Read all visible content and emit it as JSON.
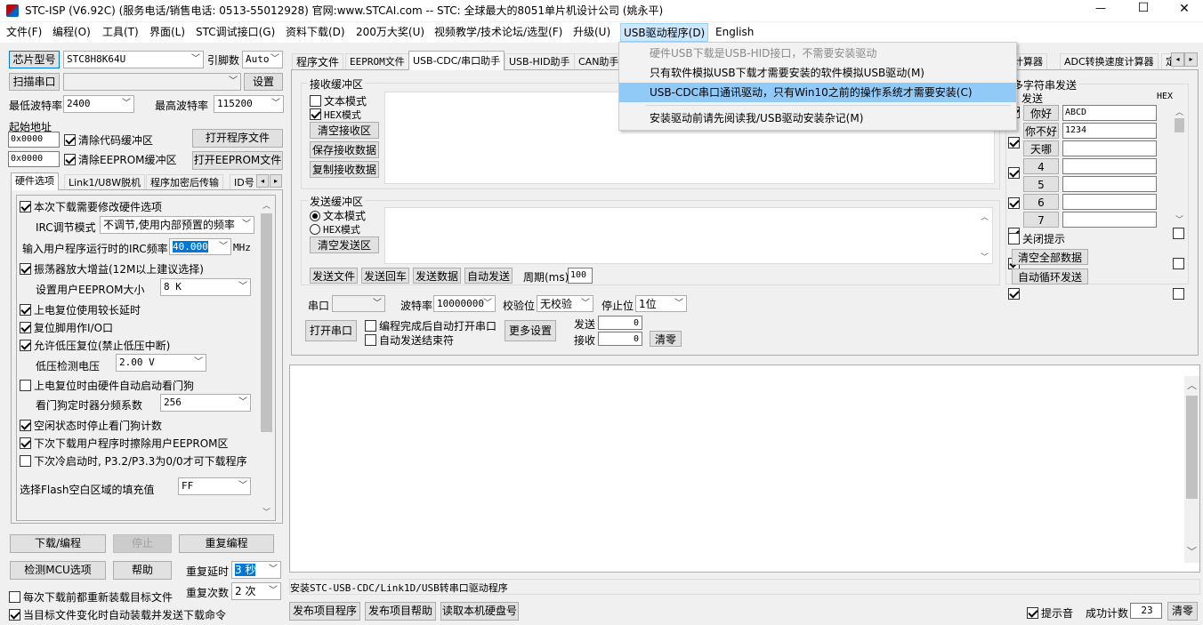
{
  "title_bar": {
    "title": "STC-ISP (V6.92C) (服务电话/销售电话: 0513-55012928) 官网:www.STCAI.com  -- STC: 全球最大的8051单片机设计公司 (姚永平)",
    "minimize": "—",
    "maximize": "☐",
    "close": "✕"
  },
  "menu": [
    "文件(F)",
    "编程(O)",
    "工具(T)",
    "界面(L)",
    "STC调试接口(G)",
    "资料下载(D)",
    "200万大奖(U)",
    "视频教学/技术论坛/选型(F)",
    "升级(U)",
    "USB驱动程序(D)",
    "English"
  ],
  "dropdown": {
    "items": [
      "硬件USB下载是USB-HID接口，不需要安装驱动",
      "只有软件模拟USB下载才需要安装的软件模拟USB驱动(M)",
      "USB-CDC串口通讯驱动，只有Win10之前的操作系统才需要安装(C)",
      "安装驱动前请先阅读我/USB驱动安装杂记(M)"
    ]
  },
  "left": {
    "chip_btn": "芯片型号",
    "chip_value": "STC8H8K64U",
    "pin_label": "引脚数",
    "pin_value": "Auto",
    "scan_btn": "扫描串口",
    "port_value": "",
    "settings_btn": "设置",
    "min_baud_label": "最低波特率",
    "min_baud": "2400",
    "max_baud_label": "最高波特率",
    "max_baud": "115200",
    "start_addr_label": "起始地址",
    "addr1": "0x0000",
    "clear_code": "清除代码缓冲区",
    "open_prog": "打开程序文件",
    "addr2": "0x0000",
    "clear_eeprom": "清除EEPROM缓冲区",
    "open_eeprom": "打开EEPROM文件",
    "tabs": [
      "硬件选项",
      "Link1/U8W脱机",
      "程序加密后传输",
      "ID号"
    ],
    "hw": {
      "o1": "本次下载需要修改硬件选项",
      "irc_mode_label": "IRC调节模式",
      "irc_mode": "不调节,使用内部预置的频率",
      "freq_label": "输入用户程序运行时的IRC频率",
      "freq": "40.000",
      "freq_unit": "MHz",
      "o2": "振荡器放大增益(12M以上建议选择)",
      "eeprom_label": "设置用户EEPROM大小",
      "eeprom": "8   K",
      "o3": "上电复位使用较长延时",
      "o4": "复位脚用作I/O口",
      "o5": "允许低压复位(禁止低压中断)",
      "lv_label": "低压检测电压",
      "lv": "2.00 V",
      "o6": "上电复位时由硬件自动启动看门狗",
      "wdt_label": "看门狗定时器分频系数",
      "wdt": "256",
      "o7": "空闲状态时停止看门狗计数",
      "o8": "下次下载用户程序时擦除用户EEPROM区",
      "o9": "下次冷启动时, P3.2/P3.3为0/0才可下载程序",
      "fill_label": "选择Flash空白区域的填充值",
      "fill": "FF"
    },
    "download_btn": "下载/编程",
    "stop_btn": "停止",
    "reprogram_btn": "重复编程",
    "check_mcu_btn": "检测MCU选项",
    "help_btn": "帮助",
    "repeat_delay_label": "重复延时",
    "repeat_delay": "3 秒",
    "reload_label": "每次下载前都重新装载目标文件",
    "repeat_count_label": "重复次数",
    "repeat_count": "2 次",
    "auto_send_label": "当目标文件变化时自动装载并发送下载命令"
  },
  "right": {
    "tabs": [
      "程序文件",
      "EEPROM文件",
      "USB-CDC/串口助手",
      "USB-HID助手",
      "CAN助手"
    ],
    "tabs_right": [
      "计算器",
      "ADC转换速度计算器",
      "定"
    ],
    "recv": {
      "title": "接收缓冲区",
      "text_mode": "文本模式",
      "hex_mode": "HEX模式",
      "clear": "清空接收区",
      "save": "保存接收数据",
      "copy": "复制接收数据"
    },
    "send": {
      "title": "发送缓冲区",
      "text_mode": "文本模式",
      "hex_mode": "HEX模式",
      "clear": "清空发送区"
    },
    "send_file": "发送文件",
    "send_enter": "发送回车",
    "send_data": "发送数据",
    "auto_send": "自动发送",
    "period_label": "周期(ms)",
    "period": "100",
    "port_label": "串口",
    "baud_label": "波特率",
    "baud": "10000000",
    "parity_label": "校验位",
    "parity": "无校验",
    "stop_label": "停止位",
    "stop": "1位",
    "open_port": "打开串口",
    "opt1": "编程完成后自动打开串口",
    "opt2": "自动发送结束符",
    "more_settings": "更多设置",
    "sent_label": "发送",
    "sent_val": "0",
    "recv_label": "接收",
    "recv_val": "0",
    "clear_cnt": "清零",
    "multi": {
      "title": "多字符串发送",
      "send_col": "发送",
      "hex_col": "HEX",
      "rows": [
        {
          "label": "你好",
          "value": "ABCD"
        },
        {
          "label": "你不好",
          "value": "1234"
        },
        {
          "label": "天哪",
          "value": ""
        },
        {
          "label": "4",
          "value": ""
        },
        {
          "label": "5",
          "value": ""
        },
        {
          "label": "6",
          "value": ""
        },
        {
          "label": "7",
          "value": ""
        }
      ],
      "close_tip": "关闭提示",
      "clear_all": "清空全部数据",
      "auto_loop": "自动循环发送"
    },
    "status_text": "安装STC-USB-CDC/Link1D/USB转串口驱动程序"
  },
  "bottom": {
    "publish_prog": "发布项目程序",
    "publish_help": "发布项目帮助",
    "read_disk": "读取本机硬盘号",
    "beep": "提示音",
    "success_label": "成功计数",
    "success_val": "23",
    "clear": "清零"
  }
}
